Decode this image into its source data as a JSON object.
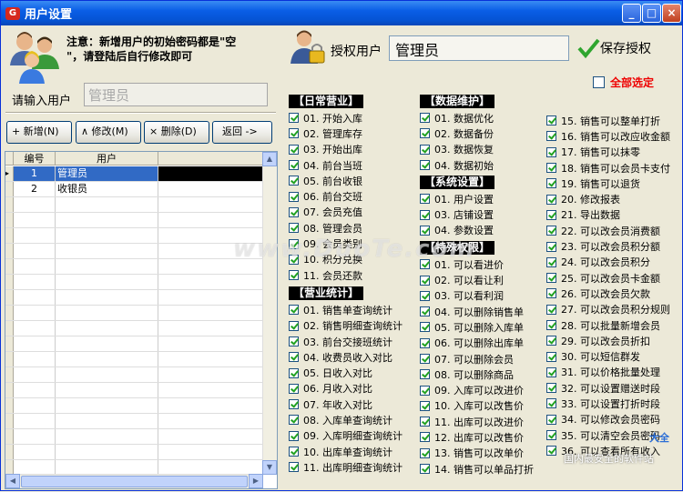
{
  "window": {
    "title": "用户设置"
  },
  "left": {
    "notice_line1": "注意：新增用户的初始密码都是\"空",
    "notice_line2": "\"，请登陆后自行修改即可",
    "input_label": "请输入用户",
    "input_value": "管理员",
    "buttons": {
      "add": "+ 新增(N)",
      "edit": "∧ 修改(M)",
      "delete": "× 删除(D)",
      "back": "返回 ->"
    },
    "grid": {
      "headers": [
        "编号",
        "用户"
      ],
      "rows": [
        {
          "id": "1",
          "name": "管理员",
          "selected": true
        },
        {
          "id": "2",
          "name": "收银员",
          "selected": false
        }
      ]
    }
  },
  "right": {
    "auth_label": "授权用户",
    "auth_value": "管理员",
    "save_label": "保存授权",
    "select_all": "全部选定",
    "col1": [
      {
        "section": "【日常营业】",
        "items": [
          "01. 开始入库",
          "02. 管理库存",
          "03. 开始出库",
          "04. 前台当班",
          "05. 前台收银",
          "06. 前台交班",
          "07. 会员充值",
          "08. 管理会员",
          "09. 会员类别",
          "10. 积分兑换",
          "11. 会员还款"
        ]
      },
      {
        "section": "【营业统计】",
        "items": [
          "01. 销售单查询统计",
          "02. 销售明细查询统计",
          "03. 前台交接班统计",
          "04. 收费员收入对比",
          "05. 日收入对比",
          "06. 月收入对比",
          "07. 年收入对比",
          "08. 入库单查询统计",
          "09. 入库明细查询统计",
          "10. 出库单查询统计",
          "11. 出库明细查询统计"
        ]
      }
    ],
    "col2": [
      {
        "section": "【数据维护】",
        "items": [
          "01. 数据优化",
          "02. 数据备份",
          "03. 数据恢复",
          "04. 数据初始"
        ]
      },
      {
        "section": "【系统设置】",
        "items": [
          "01. 用户设置",
          "03. 店铺设置",
          "04. 参数设置"
        ]
      },
      {
        "section": "【特殊权限】",
        "items": [
          "01. 可以看进价",
          "02. 可以看让利",
          "03. 可以看利润",
          "04. 可以删除销售单",
          "05. 可以删除入库单",
          "06. 可以删除出库单",
          "07. 可以删除会员",
          "08. 可以删除商品",
          "09. 入库可以改进价",
          "10. 入库可以改售价",
          "11. 出库可以改进价",
          "12. 出库可以改售价",
          "13. 销售可以改单价",
          "14. 销售可以单品打折"
        ]
      }
    ],
    "col3": {
      "items": [
        "15. 销售可以整单打折",
        "16. 销售可以改应收金额",
        "17. 销售可以抹零",
        "18. 销售可以会员卡支付",
        "19. 销售可以退货",
        "20. 修改报表",
        "21. 导出数据",
        "22. 可以改会员消费额",
        "23. 可以改会员积分额",
        "24. 可以改会员积分",
        "25. 可以改会员卡金额",
        "26. 可以改会员欠款",
        "27. 可以改会员积分规则",
        "28. 可以批量新增会员",
        "29. 可以改会员折扣",
        "30. 可以短信群发",
        "31. 可以价格批量处理",
        "32. 可以设置赠送时段",
        "33. 可以设置打折时段",
        "34. 可以修改会员密码",
        "35. 可以清空会员密码",
        "36. 可以查看所有收入"
      ]
    }
  },
  "watermark": {
    "main": "www.DuoTe.com",
    "corner": "国内最安全的软件站",
    "logo": "大全"
  },
  "icons": {
    "app": "app-logo-icon",
    "users": "users-icon",
    "auth": "user-lock-icon",
    "save": "checkmark-icon"
  }
}
